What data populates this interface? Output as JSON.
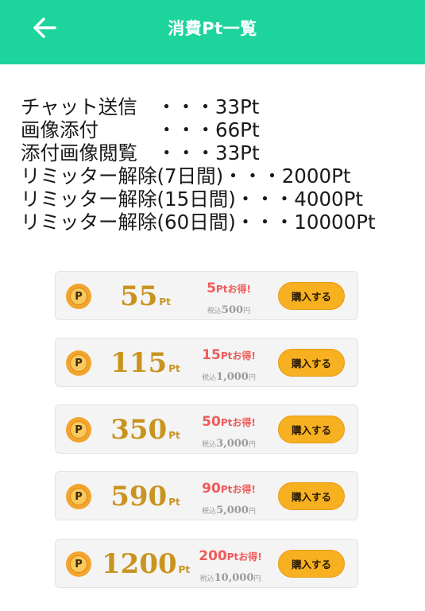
{
  "header": {
    "title": "消費Pt一覧",
    "back_icon": "arrow-left-icon"
  },
  "costs": [
    {
      "label": "チャット送信",
      "dots": "　・・・",
      "value": "33Pt"
    },
    {
      "label": "画像添付",
      "dots": "　　　・・・",
      "value": "66Pt"
    },
    {
      "label": "添付画像閲覧",
      "dots": "　・・・",
      "value": "33Pt"
    },
    {
      "label": "リミッター解除(7日間)",
      "dots": "・・・",
      "value": "2000Pt"
    },
    {
      "label": "リミッター解除(15日間)",
      "dots": "・・・",
      "value": "4000Pt"
    },
    {
      "label": "リミッター解除(60日間)",
      "dots": "・・・",
      "value": "10000Pt"
    }
  ],
  "coin_letter": "P",
  "plans": [
    {
      "points": "55",
      "unit": "Pt",
      "bonus": "5",
      "bonus_text": "Ptお得!",
      "tax_label": "税込",
      "price": "500",
      "yen": "円",
      "button": "購入する"
    },
    {
      "points": "115",
      "unit": "Pt",
      "bonus": "15",
      "bonus_text": "Ptお得!",
      "tax_label": "税込",
      "price": "1,000",
      "yen": "円",
      "button": "購入する"
    },
    {
      "points": "350",
      "unit": "Pt",
      "bonus": "50",
      "bonus_text": "Ptお得!",
      "tax_label": "税込",
      "price": "3,000",
      "yen": "円",
      "button": "購入する"
    },
    {
      "points": "590",
      "unit": "Pt",
      "bonus": "90",
      "bonus_text": "Ptお得!",
      "tax_label": "税込",
      "price": "5,000",
      "yen": "円",
      "button": "購入する"
    },
    {
      "points": "1200",
      "unit": "Pt",
      "bonus": "200",
      "bonus_text": "Ptお得!",
      "tax_label": "税込",
      "price": "10,000",
      "yen": "円",
      "button": "購入する"
    }
  ],
  "colors": {
    "header_bg": "#1ed49d",
    "points_gold": "#c9941e",
    "bonus_red": "#f05a5a",
    "button_orange": "#f7b020"
  }
}
